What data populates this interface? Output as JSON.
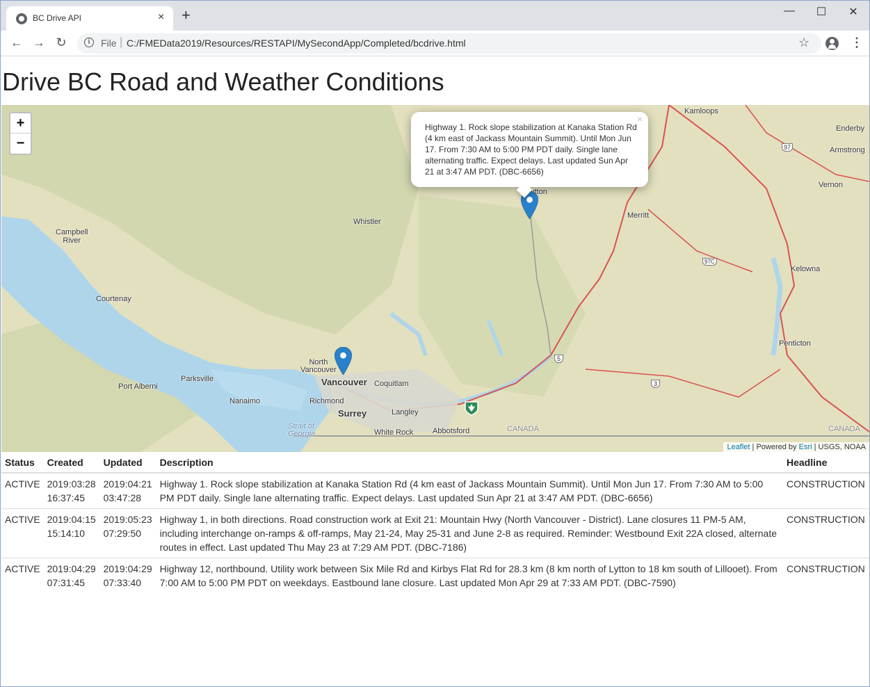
{
  "browser": {
    "tab_title": "BC Drive API",
    "tab_close": "×",
    "new_tab": "+",
    "window_controls": {
      "minimize": "—",
      "maximize": "☐",
      "close": "✕"
    },
    "nav": {
      "back": "←",
      "forward": "→",
      "reload": "↻"
    },
    "address": {
      "scheme": "File",
      "separator": "|",
      "url": "C:/FMEData2019/Resources/RESTAPI/MySecondApp/Completed/bcdrive.html"
    },
    "icons": {
      "info": "i",
      "star": "☆",
      "menu": "⋮"
    }
  },
  "page": {
    "title": "Drive BC Road and Weather Conditions"
  },
  "map": {
    "zoom_in": "+",
    "zoom_out": "−",
    "popup": {
      "close": "×",
      "text": "Highway 1. Rock slope stabilization at Kanaka Station Rd (4 km east of Jackass Mountain Summit). Until Mon Jun 17. From 7:30 AM to 5:00 PM PDT daily. Single lane alternating traffic. Expect delays. Last updated Sun Apr 21 at 3:47 AM PDT. (DBC-6656)"
    },
    "labels": {
      "kamloops": "Kamloops",
      "enderby": "Enderby",
      "armstrong": "Armstrong",
      "vernon": "Vernon",
      "lytton": "ytton",
      "merritt": "Merritt",
      "whistler": "Whistler",
      "campbell_river": "Campbell\nRiver",
      "kelowna": "Kelowna",
      "courtenay": "Courtenay",
      "penticton": "Penticton",
      "north_vancouver": "North\nVancouver",
      "vancouver": "Vancouver",
      "coquitlam": "Coquitlam",
      "parksville": "Parksville",
      "port_alberni": "Port Alberni",
      "nanaimo": "Nanaimo",
      "richmond": "Richmond",
      "surrey": "Surrey",
      "langley": "Langley",
      "white_rock": "White Rock",
      "abbotsford": "Abbotsford",
      "canada1": "CANADA",
      "canada2": "CANADA",
      "strait": "Strait of\nGeorgia",
      "hwy97": "97",
      "hwy97c": "97C",
      "hwy5": "5",
      "hwy3": "3"
    },
    "attribution": {
      "leaflet": "Leaflet",
      "powered": " | Powered by ",
      "esri": "Esri",
      "rest": " | USGS, NOAA"
    }
  },
  "table": {
    "headers": {
      "status": "Status",
      "created": "Created",
      "updated": "Updated",
      "description": "Description",
      "headline": "Headline"
    },
    "rows": [
      {
        "status": "ACTIVE",
        "created": "2019:03:28 16:37:45",
        "updated": "2019:04:21 03:47:28",
        "description": "Highway 1. Rock slope stabilization at Kanaka Station Rd (4 km east of Jackass Mountain Summit). Until Mon Jun 17. From 7:30 AM to 5:00 PM PDT daily. Single lane alternating traffic. Expect delays. Last updated Sun Apr 21 at 3:47 AM PDT. (DBC-6656)",
        "headline": "CONSTRUCTION"
      },
      {
        "status": "ACTIVE",
        "created": "2019:04:15 15:14:10",
        "updated": "2019:05:23 07:29:50",
        "description": "Highway 1, in both directions. Road construction work at Exit 21: Mountain Hwy (North Vancouver - District). Lane closures 11 PM-5 AM, including interchange on-ramps & off-ramps, May 21-24, May 25-31 and June 2-8 as required. Reminder: Westbound Exit 22A closed, alternate routes in effect. Last updated Thu May 23 at 7:29 AM PDT. (DBC-7186)",
        "headline": "CONSTRUCTION"
      },
      {
        "status": "ACTIVE",
        "created": "2019:04:29 07:31:45",
        "updated": "2019:04:29 07:33:40",
        "description": "Highway 12, northbound. Utility work between Six Mile Rd and Kirbys Flat Rd for 28.3 km (8 km north of Lytton to 18 km south of Lillooet). From 7:00 AM to 5:00 PM PDT on weekdays. Eastbound lane closure. Last updated Mon Apr 29 at 7:33 AM PDT. (DBC-7590)",
        "headline": "CONSTRUCTION"
      }
    ]
  },
  "colors": {
    "marker": "#2a81cb",
    "water": "#aed5ea",
    "land": "#e6e3c6",
    "road_major": "#d9534f"
  }
}
